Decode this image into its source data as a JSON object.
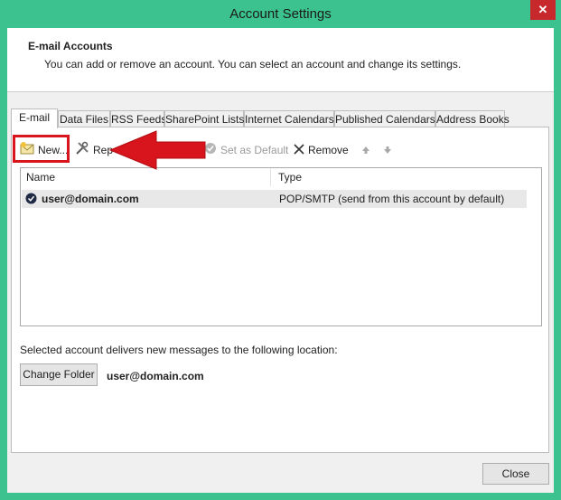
{
  "window": {
    "title": "Account Settings",
    "close_glyph": "✕",
    "accent_color": "#3bc28e"
  },
  "header": {
    "title": "E-mail Accounts",
    "description": "You can add or remove an account. You can select an account and change its settings."
  },
  "tabs": [
    {
      "label": "E-mail",
      "active": true
    },
    {
      "label": "Data Files"
    },
    {
      "label": "RSS Feeds"
    },
    {
      "label": "SharePoint Lists"
    },
    {
      "label": "Internet Calendars"
    },
    {
      "label": "Published Calendars"
    },
    {
      "label": "Address Books"
    }
  ],
  "toolbar": {
    "new_label": "New...",
    "repair_label": "Rep",
    "set_default_label": "Set as Default",
    "remove_label": "Remove",
    "up_icon": "arrow-up-icon",
    "down_icon": "arrow-down-icon"
  },
  "accounts_table": {
    "columns": [
      "Name",
      "Type"
    ],
    "rows": [
      {
        "name": "user@domain.com",
        "type": "POP/SMTP (send from this account by default)",
        "default": true
      }
    ]
  },
  "delivery": {
    "text": "Selected account delivers new messages to the following location:",
    "change_folder_label": "Change Folder",
    "location": "user@domain.com"
  },
  "footer": {
    "close_label": "Close"
  },
  "annotation": {
    "color": "#d8141c",
    "target": "new-button"
  }
}
